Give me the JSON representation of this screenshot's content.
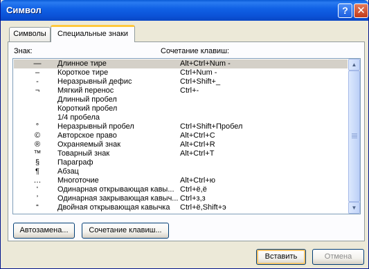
{
  "window": {
    "title": "Символ",
    "help_label": "?",
    "close_label": "✕"
  },
  "tabs": [
    {
      "label": "Символы",
      "active": false
    },
    {
      "label": "Специальные знаки",
      "active": true
    }
  ],
  "columns": {
    "sign": "Знак:",
    "shortcut": "Сочетание клавиш:"
  },
  "rows": [
    {
      "symbol": "—",
      "name": "Длинное тире",
      "shortcut": "Alt+Ctrl+Num -",
      "selected": true
    },
    {
      "symbol": "–",
      "name": "Короткое тире",
      "shortcut": "Ctrl+Num -"
    },
    {
      "symbol": "-",
      "name": "Неразрывный дефис",
      "shortcut": "Ctrl+Shift+_"
    },
    {
      "symbol": "¬",
      "name": "Мягкий перенос",
      "shortcut": "Ctrl+-"
    },
    {
      "symbol": "",
      "name": "Длинный пробел",
      "shortcut": ""
    },
    {
      "symbol": "",
      "name": "Короткий пробел",
      "shortcut": ""
    },
    {
      "symbol": "",
      "name": "1/4 пробела",
      "shortcut": ""
    },
    {
      "symbol": "°",
      "name": "Неразрывный пробел",
      "shortcut": "Ctrl+Shift+Пробел"
    },
    {
      "symbol": "©",
      "name": "Авторское право",
      "shortcut": "Alt+Ctrl+C"
    },
    {
      "symbol": "®",
      "name": "Охраняемый знак",
      "shortcut": "Alt+Ctrl+R"
    },
    {
      "symbol": "™",
      "name": "Товарный знак",
      "shortcut": "Alt+Ctrl+T"
    },
    {
      "symbol": "§",
      "name": "Параграф",
      "shortcut": ""
    },
    {
      "symbol": "¶",
      "name": "Абзац",
      "shortcut": ""
    },
    {
      "symbol": "…",
      "name": "Многоточие",
      "shortcut": "Alt+Ctrl+ю"
    },
    {
      "symbol": "‘",
      "name": "Одинарная открывающая кавы...",
      "shortcut": "Ctrl+ё,ё"
    },
    {
      "symbol": "’",
      "name": "Одинарная закрывающая кавыч...",
      "shortcut": "Ctrl+з,з"
    },
    {
      "symbol": "“",
      "name": "Двойная открывающая кавычка",
      "shortcut": "Ctrl+ё,Shift+э"
    }
  ],
  "scrollbar": {
    "up_icon": "scroll-up-arrow-icon",
    "down_icon": "scroll-down-arrow-icon",
    "up_glyph": "▲",
    "down_glyph": "▼"
  },
  "buttons": {
    "autocorrect": "Автозамена...",
    "shortcut": "Сочетание клавиш...",
    "insert": "Вставить",
    "cancel": "Отмена"
  },
  "colors": {
    "titlebar": "#0b53d8",
    "selection": "#d4d0c8",
    "active_tab_accent": "#ffc83c",
    "close_button": "#c23a1a"
  }
}
